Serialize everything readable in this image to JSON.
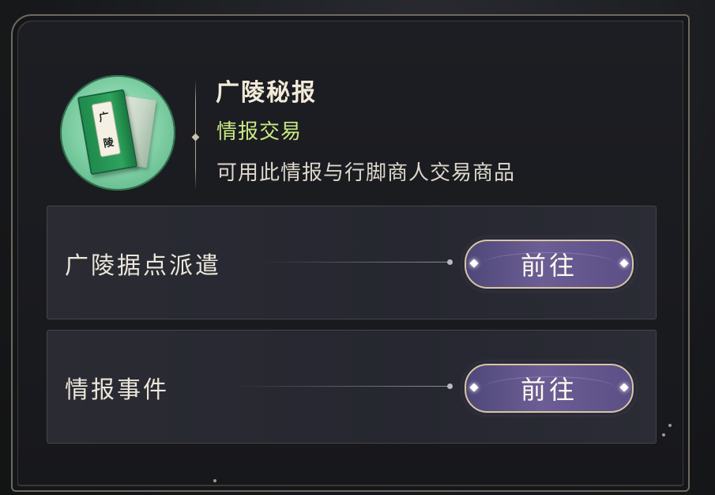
{
  "item": {
    "icon_name": "guangling-secret-report-book-icon",
    "icon_text": [
      "广",
      "陵"
    ],
    "title": "广陵秘报",
    "category": "情报交易",
    "description": "可用此情报与行脚商人交易商品"
  },
  "colors": {
    "title": "#f2ead8",
    "category": "#c9ea84",
    "description": "#ddd8cb",
    "button_fill": "#5b4f86",
    "button_border": "#d6c79f"
  },
  "rows": [
    {
      "label": "广陵据点派遣",
      "button_label": "前往"
    },
    {
      "label": "情报事件",
      "button_label": "前往"
    }
  ]
}
